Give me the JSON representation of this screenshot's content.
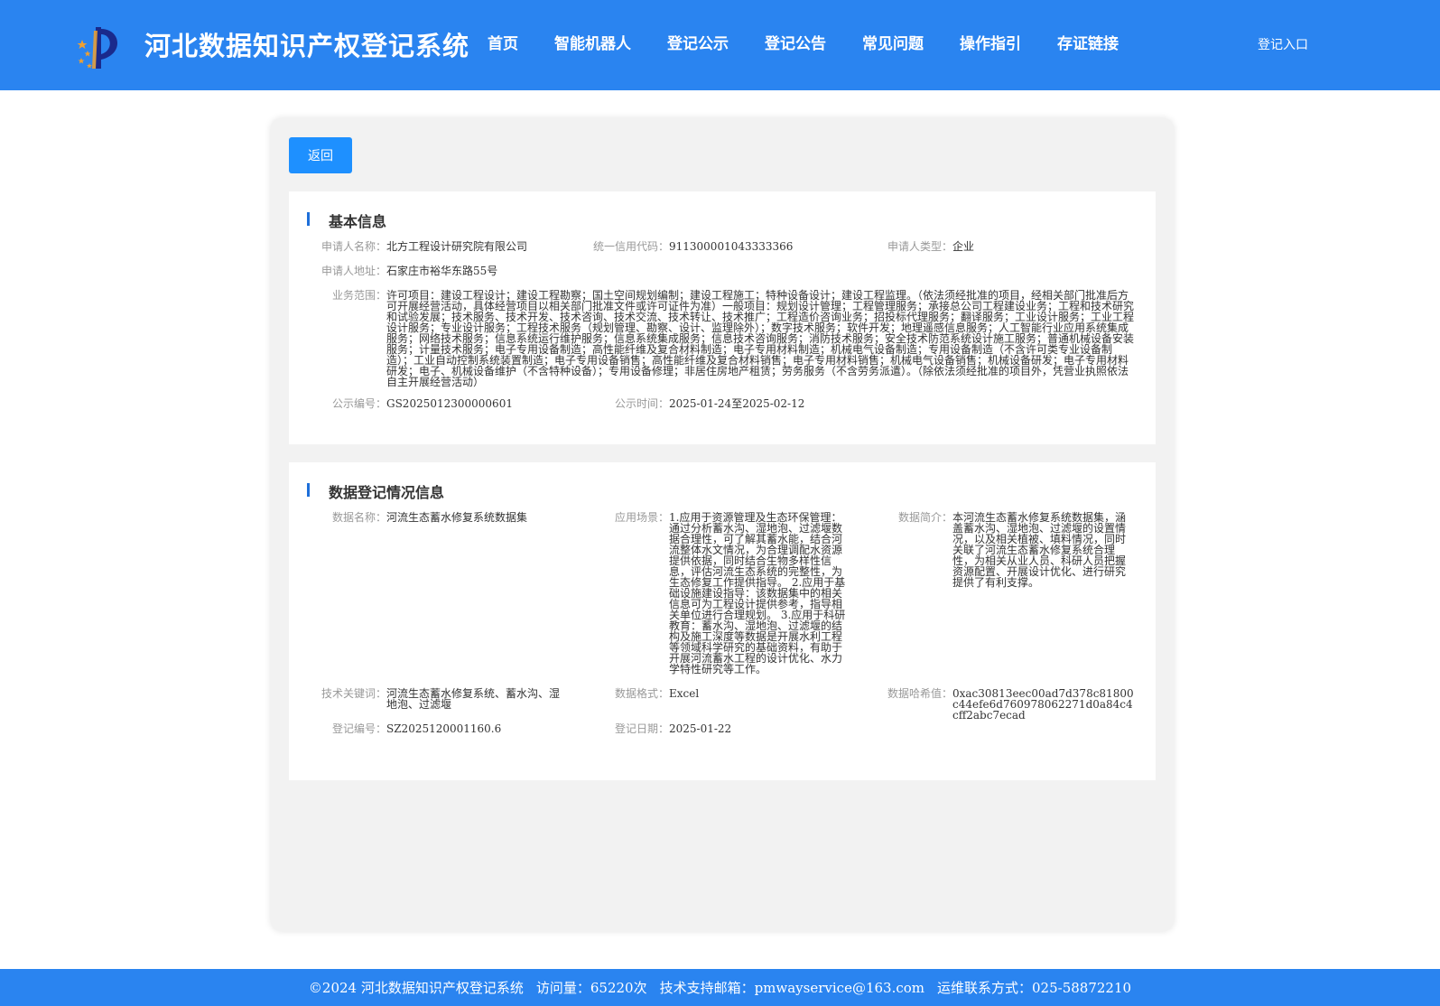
{
  "header": {
    "site_title": "河北数据知识产权登记系统",
    "nav": [
      "首页",
      "智能机器人",
      "登记公示",
      "登记公告",
      "常见问题",
      "操作指引",
      "存证链接"
    ],
    "login": "登记入口",
    "colors": {
      "header_bg": "#2a84f0",
      "logo_blue": "#1a2a8c",
      "logo_star": "#f0a030"
    }
  },
  "main": {
    "back_label": "返回",
    "basic": {
      "title": "基本信息",
      "applicant_name_label": "申请人名称：",
      "applicant_name": "北方工程设计研究院有限公司",
      "credit_code_label": "统一信用代码：",
      "credit_code": "911300001043333366",
      "applicant_type_label": "申请人类型：",
      "applicant_type": "企业",
      "address_label": "申请人地址：",
      "address": "石家庄市裕华东路55号",
      "scope_label": "业务范围：",
      "scope": "许可项目：建设工程设计；建设工程勘察；国土空间规划编制；建设工程施工；特种设备设计；建设工程监理。（依法须经批准的项目，经相关部门批准后方可开展经营活动，具体经营项目以相关部门批准文件或许可证件为准）一般项目：规划设计管理；工程管理服务；承接总公司工程建设业务；工程和技术研究和试验发展；技术服务、技术开发、技术咨询、技术交流、技术转让、技术推广；工程造价咨询业务；招投标代理服务；翻译服务；工业设计服务；工业工程设计服务；专业设计服务；工程技术服务（规划管理、勘察、设计、监理除外）；数字技术服务；软件开发；地理遥感信息服务；人工智能行业应用系统集成服务；网络技术服务；信息系统运行维护服务；信息系统集成服务；信息技术咨询服务；消防技术服务；安全技术防范系统设计施工服务；普通机械设备安装服务；计量技术服务；电子专用设备制造；高性能纤维及复合材料制造；电子专用材料制造；机械电气设备制造；专用设备制造（不含许可类专业设备制造）；工业自动控制系统装置制造；电子专用设备销售；高性能纤维及复合材料销售；电子专用材料销售；机械电气设备销售；机械设备研发；电子专用材料研发；电子、机械设备维护（不含特种设备）；专用设备修理；非居住房地产租赁；劳务服务（不含劳务派遣）。（除依法须经批准的项目外，凭营业执照依法自主开展经营活动）",
      "notice_no_label": "公示编号：",
      "notice_no": "GS2025012300000601",
      "notice_time_label": "公示时间：",
      "notice_time": "2025-01-24至2025-02-12"
    },
    "registration": {
      "title": "数据登记情况信息",
      "data_name_label": "数据名称：",
      "data_name": "河流生态蓄水修复系统数据集",
      "scenario_label": "应用场景：",
      "scenario": "1.应用于资源管理及生态环保管理：通过分析蓄水沟、湿地泡、过滤堰数据合理性，可了解其蓄水能，结合河流整体水文情况，为合理调配水资源提供依据，同时结合生物多样性信息，评估河流生态系统的完整性，为生态修复工作提供指导。 2.应用于基础设施建设指导：该数据集中的相关信息可为工程设计提供参考，指导相关单位进行合理规划。 3.应用于科研教育：蓄水沟、湿地泡、过滤堰的结构及施工深度等数据是开展水利工程等领域科学研究的基础资料，有助于开展河流蓄水工程的设计优化、水力学特性研究等工作。",
      "intro_label": "数据简介：",
      "intro": "本河流生态蓄水修复系统数据集，涵盖蓄水沟、湿地泡、过滤堰的设置情况，以及相关植被、填料情况，同时关联了河流生态蓄水修复系统合理性，为相关从业人员、科研人员把握资源配置、开展设计优化、进行研究提供了有利支撑。",
      "keywords_label": "技术关键词：",
      "keywords": "河流生态蓄水修复系统、蓄水沟、湿地泡、过滤堰",
      "format_label": "数据格式：",
      "format": "Excel",
      "hash_label": "数据哈希值：",
      "hash": "0xac30813eec00ad7d378c81800c44efe6d760978062271d0a84c4cff2abc7ecad",
      "reg_no_label": "登记编号：",
      "reg_no": "SZ2025120001160.6",
      "reg_date_label": "登记日期：",
      "reg_date": "2025-01-22"
    }
  },
  "footer": {
    "copyright": "©2024 河北数据知识产权登记系统",
    "visits": "访问量：65220次",
    "email": "技术支持邮箱：pmwayservice@163.com",
    "contact": "运维联系方式：025-58872210"
  }
}
